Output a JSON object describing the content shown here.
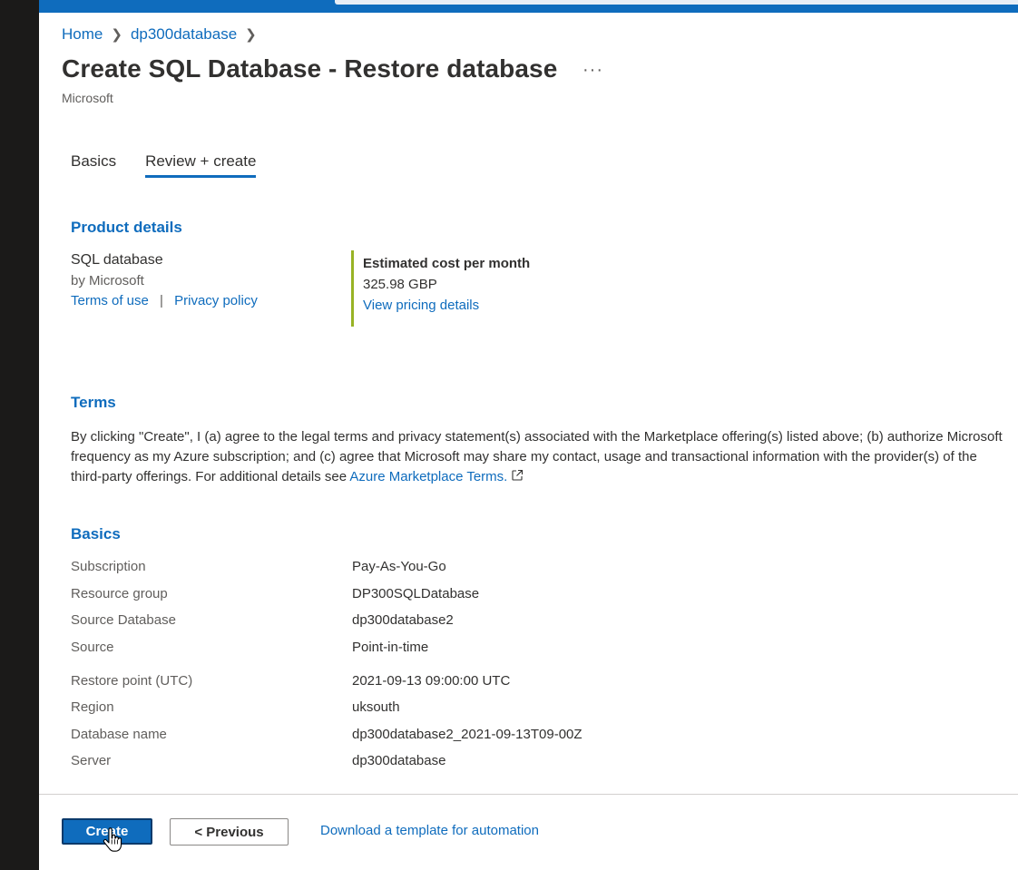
{
  "breadcrumb": [
    {
      "label": "Home"
    },
    {
      "label": "dp300database"
    }
  ],
  "page": {
    "title": "Create SQL Database - Restore database",
    "more_label": "···",
    "publisher": "Microsoft"
  },
  "tabs": [
    {
      "label": "Basics",
      "active": false
    },
    {
      "label": "Review + create",
      "active": true
    }
  ],
  "product_details": {
    "heading": "Product details",
    "name": "SQL database",
    "by": "by Microsoft",
    "terms_link": "Terms of use",
    "separator": "|",
    "privacy_link": "Privacy policy",
    "cost_label": "Estimated cost per month",
    "cost_value": "325.98 GBP",
    "pricing_link": "View pricing details"
  },
  "terms": {
    "heading": "Terms",
    "line1": "By clicking \"Create\", I (a) agree to the legal terms and privacy statement(s) associated with the Marketplace offering(s) listed above; (b) authorize Microsoft",
    "line2": "frequency as my Azure subscription; and (c) agree that Microsoft may share my contact, usage and transactional information with the provider(s) of the",
    "line3_prefix": "third-party offerings. For additional details see ",
    "marketplace_link": "Azure Marketplace Terms."
  },
  "basics": {
    "heading": "Basics",
    "rows": [
      {
        "key": "Subscription",
        "value": "Pay-As-You-Go"
      },
      {
        "key": "Resource group",
        "value": "DP300SQLDatabase"
      },
      {
        "key": "Source Database",
        "value": "dp300database2"
      },
      {
        "key": "Source",
        "value": "Point-in-time"
      },
      {
        "key": "Restore point (UTC)",
        "value": "2021-09-13 09:00:00 UTC"
      },
      {
        "key": "Region",
        "value": "uksouth"
      },
      {
        "key": "Database name",
        "value": "dp300database2_2021-09-13T09-00Z"
      },
      {
        "key": "Server",
        "value": "dp300database"
      }
    ]
  },
  "footer": {
    "create_label": "Create",
    "previous_label": "< Previous",
    "download_link": "Download a template for automation"
  },
  "colors": {
    "accent": "#0f6cbd",
    "cost_border": "#98b325"
  }
}
